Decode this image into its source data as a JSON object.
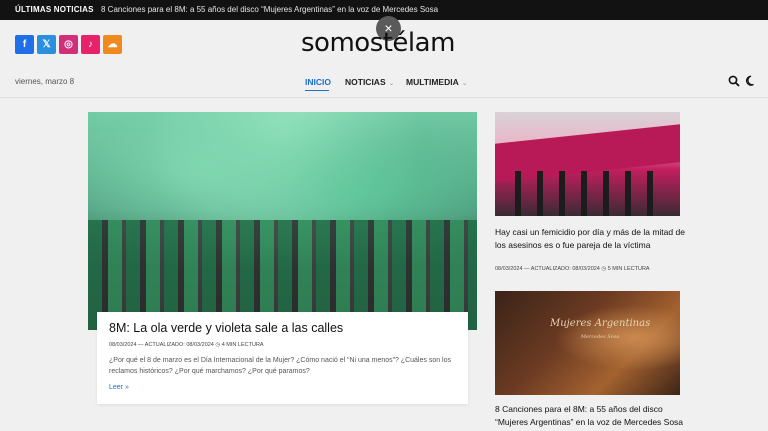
{
  "ticker": {
    "label": "ÚLTIMAS NOTICIAS",
    "headline": "8 Canciones para el 8M: a 55 años del disco “Mujeres Argentinas” en la voz de Mercedes Sosa"
  },
  "close_icon": "×",
  "social": [
    {
      "icon": "facebook-icon",
      "glyph": "f",
      "color": "#1f6fe8"
    },
    {
      "icon": "x-twitter-icon",
      "glyph": "𝕏",
      "color": "#2b8fe0"
    },
    {
      "icon": "instagram-icon",
      "glyph": "◎",
      "color": "#d12f7a"
    },
    {
      "icon": "tiktok-icon",
      "glyph": "♪",
      "color": "#e8216b"
    },
    {
      "icon": "soundcloud-icon",
      "glyph": "☁",
      "color": "#f08a1f"
    }
  ],
  "brand": {
    "logo": "somostélam"
  },
  "header": {
    "date": "viernes, marzo 8"
  },
  "nav": {
    "items": [
      {
        "label": "INICIO",
        "active": true
      },
      {
        "label": "NOTICIAS",
        "has_dropdown": true
      },
      {
        "label": "MULTIMEDIA",
        "has_dropdown": true
      }
    ],
    "chevron": "⌄",
    "accent": "#1a6fd0"
  },
  "hero": {
    "title": "8M: La ola verde y violeta sale a las calles",
    "meta": "08/03/2024  —  ACTUALIZADO:  08/03/2024      ◷  4 MIN LECTURA",
    "excerpt": "¿Por qué el 8 de marzo es el Día Internacional de la Mujer? ¿Cómo nació el “Ni una menos”? ¿Cuáles son los reclamos históricos? ¿Por qué marchamos? ¿Por qué paramos?",
    "read_more": "Leer »"
  },
  "side": [
    {
      "title": "Hay casi un femicidio por día y más de la mitad de los asesinos es o fue pareja de la víctima",
      "meta": "08/03/2024  —  ACTUALIZADO:  08/03/2024      ◷  5 MIN LECTURA"
    },
    {
      "title": "8 Canciones para el 8M: a 55 años del disco “Mujeres Argentinas” en la voz de Mercedes Sosa",
      "image_text": "Mujeres Argentinas",
      "image_subtext": "Mercedes Sosa"
    }
  ]
}
